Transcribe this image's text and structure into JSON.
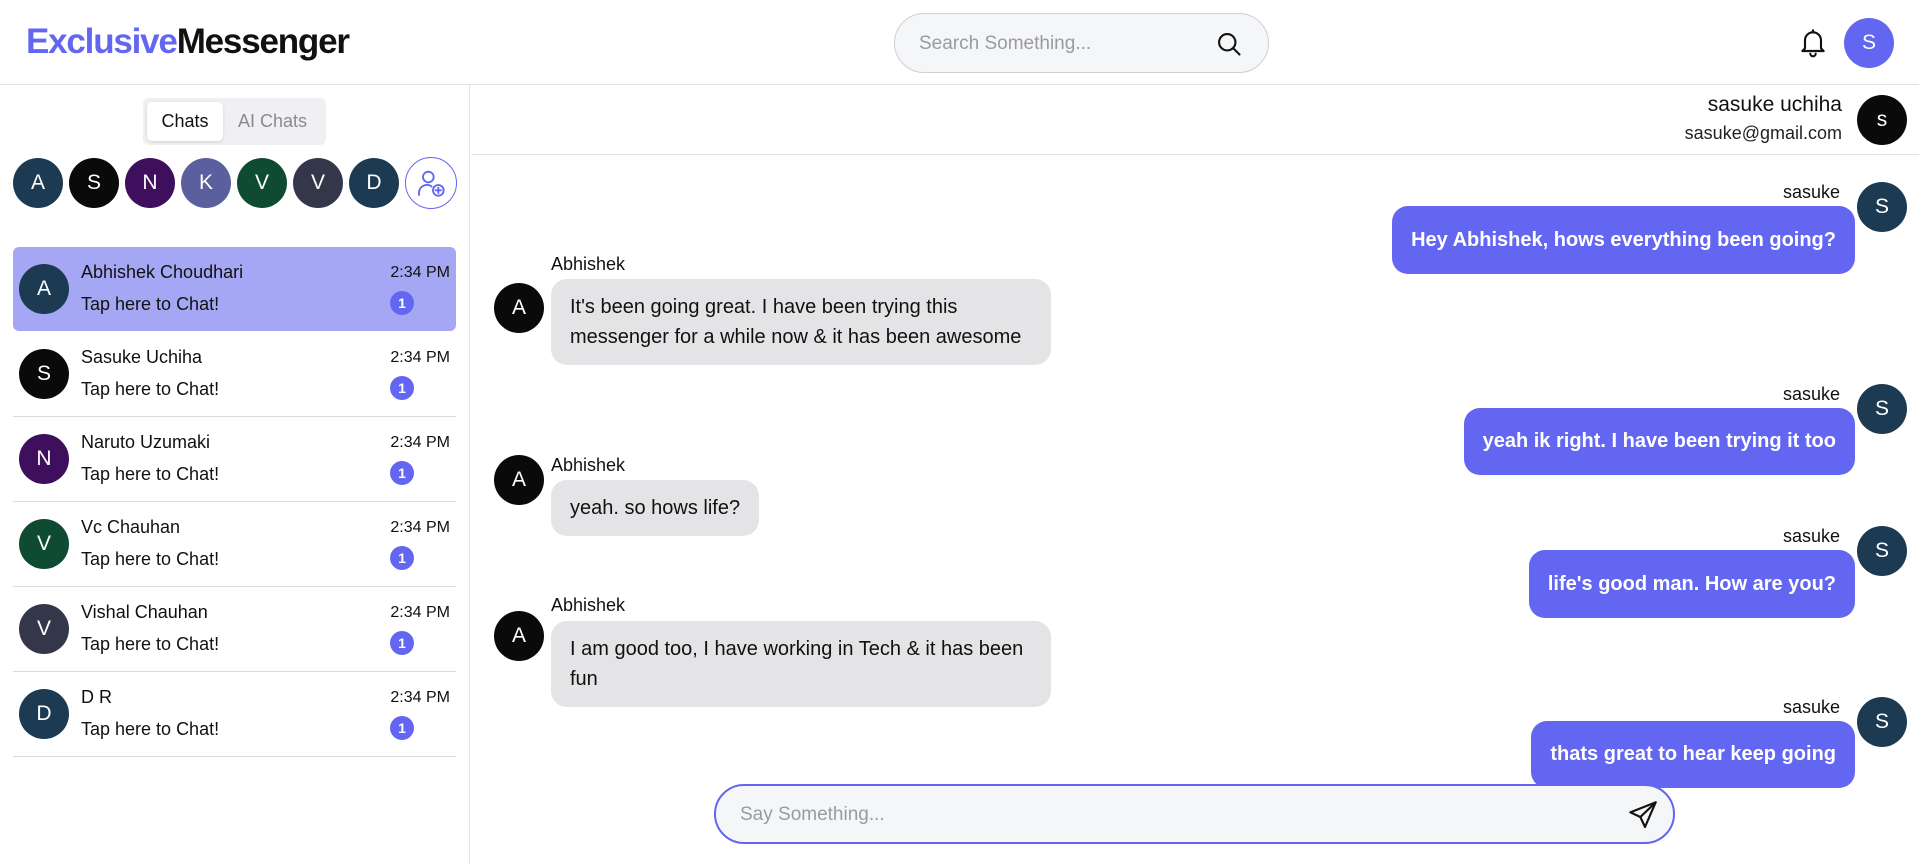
{
  "app": {
    "title_part1": "Exclusive",
    "title_part2": "Messenger"
  },
  "header": {
    "search_placeholder": "Search Something...",
    "user_initial": "S",
    "accent": "#6366f1"
  },
  "sidebar": {
    "tabs": [
      {
        "label": "Chats"
      },
      {
        "label": "AI Chats"
      }
    ],
    "recent_avatars": [
      {
        "initial": "A",
        "color": "#1c3a52"
      },
      {
        "initial": "S",
        "color": "#0a0a0a"
      },
      {
        "initial": "N",
        "color": "#3d0f5c"
      },
      {
        "initial": "K",
        "color": "#5b5f9e"
      },
      {
        "initial": "V",
        "color": "#0f4a33"
      },
      {
        "initial": "V",
        "color": "#34364a"
      },
      {
        "initial": "D",
        "color": "#1c3a52"
      }
    ],
    "chats": [
      {
        "initial": "A",
        "color": "#1c3a52",
        "name": "Abhishek Choudhari",
        "preview": "Tap here to Chat!",
        "time": "2:34 PM",
        "unread": "1"
      },
      {
        "initial": "S",
        "color": "#0a0a0a",
        "name": "Sasuke Uchiha",
        "preview": "Tap here to Chat!",
        "time": "2:34 PM",
        "unread": "1"
      },
      {
        "initial": "N",
        "color": "#3d0f5c",
        "name": "Naruto Uzumaki",
        "preview": "Tap here to Chat!",
        "time": "2:34 PM",
        "unread": "1"
      },
      {
        "initial": "V",
        "color": "#0f4a33",
        "name": "Vc Chauhan",
        "preview": "Tap here to Chat!",
        "time": "2:34 PM",
        "unread": "1"
      },
      {
        "initial": "V",
        "color": "#34364a",
        "name": "Vishal Chauhan",
        "preview": "Tap here to Chat!",
        "time": "2:34 PM",
        "unread": "1"
      },
      {
        "initial": "D",
        "color": "#1c3a52",
        "name": "D R",
        "preview": "Tap here to Chat!",
        "time": "2:34 PM",
        "unread": "1"
      }
    ]
  },
  "chat": {
    "contact_name": "sasuke uchiha",
    "contact_email": "sasuke@gmail.com",
    "contact_initial": "s",
    "messages": [
      {
        "direction": "out",
        "sender": "sasuke",
        "initial": "S",
        "text": "Hey Abhishek, hows everything been going?"
      },
      {
        "direction": "in",
        "sender": "Abhishek",
        "initial": "A",
        "text": "It's been going great. I have been trying this messenger for a while now & it has been awesome"
      },
      {
        "direction": "out",
        "sender": "sasuke",
        "initial": "S",
        "text": "yeah ik right. I have been trying it too"
      },
      {
        "direction": "in",
        "sender": "Abhishek",
        "initial": "A",
        "text": "yeah. so hows life?"
      },
      {
        "direction": "out",
        "sender": "sasuke",
        "initial": "S",
        "text": "life's good man. How are you?"
      },
      {
        "direction": "in",
        "sender": "Abhishek",
        "initial": "A",
        "text": "I am good too, I have working in Tech & it has been fun"
      },
      {
        "direction": "out",
        "sender": "sasuke",
        "initial": "S",
        "text": "thats great to hear keep going"
      }
    ],
    "composer_placeholder": "Say Something..."
  }
}
